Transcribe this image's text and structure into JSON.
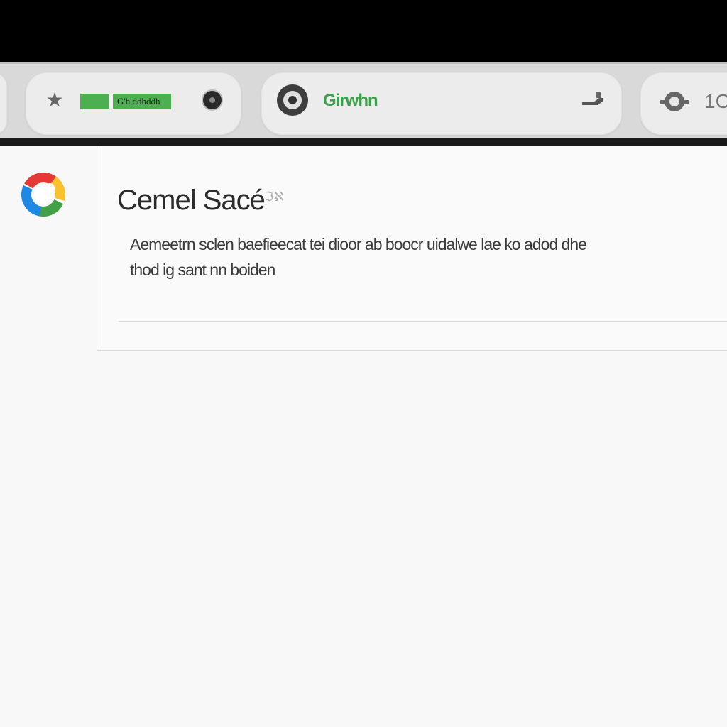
{
  "toolbar": {
    "chip_label": "G'h ddhddh",
    "address_text": "Girwhn",
    "edge_text": "1C"
  },
  "icons": {
    "star": "star-icon",
    "record": "record-icon",
    "camera": "camera-icon",
    "share": "share-icon",
    "toggle": "toggle-icon",
    "logo": "app-logo-icon"
  },
  "card": {
    "title": "Cemel Sacé",
    "title_suffix": "ℑℵ",
    "body_line1": "Aemeetrn sclen baefieecat tei dioor ab boocr uidalwe lae ko adod dhe",
    "body_line2": "thod  ig  sant nn  boiden"
  },
  "colors": {
    "accent_green": "#4caf50",
    "address_green": "#3aa04a",
    "toolbar_bg": "#d9d9d9",
    "content_bg": "#f8f8f8"
  }
}
